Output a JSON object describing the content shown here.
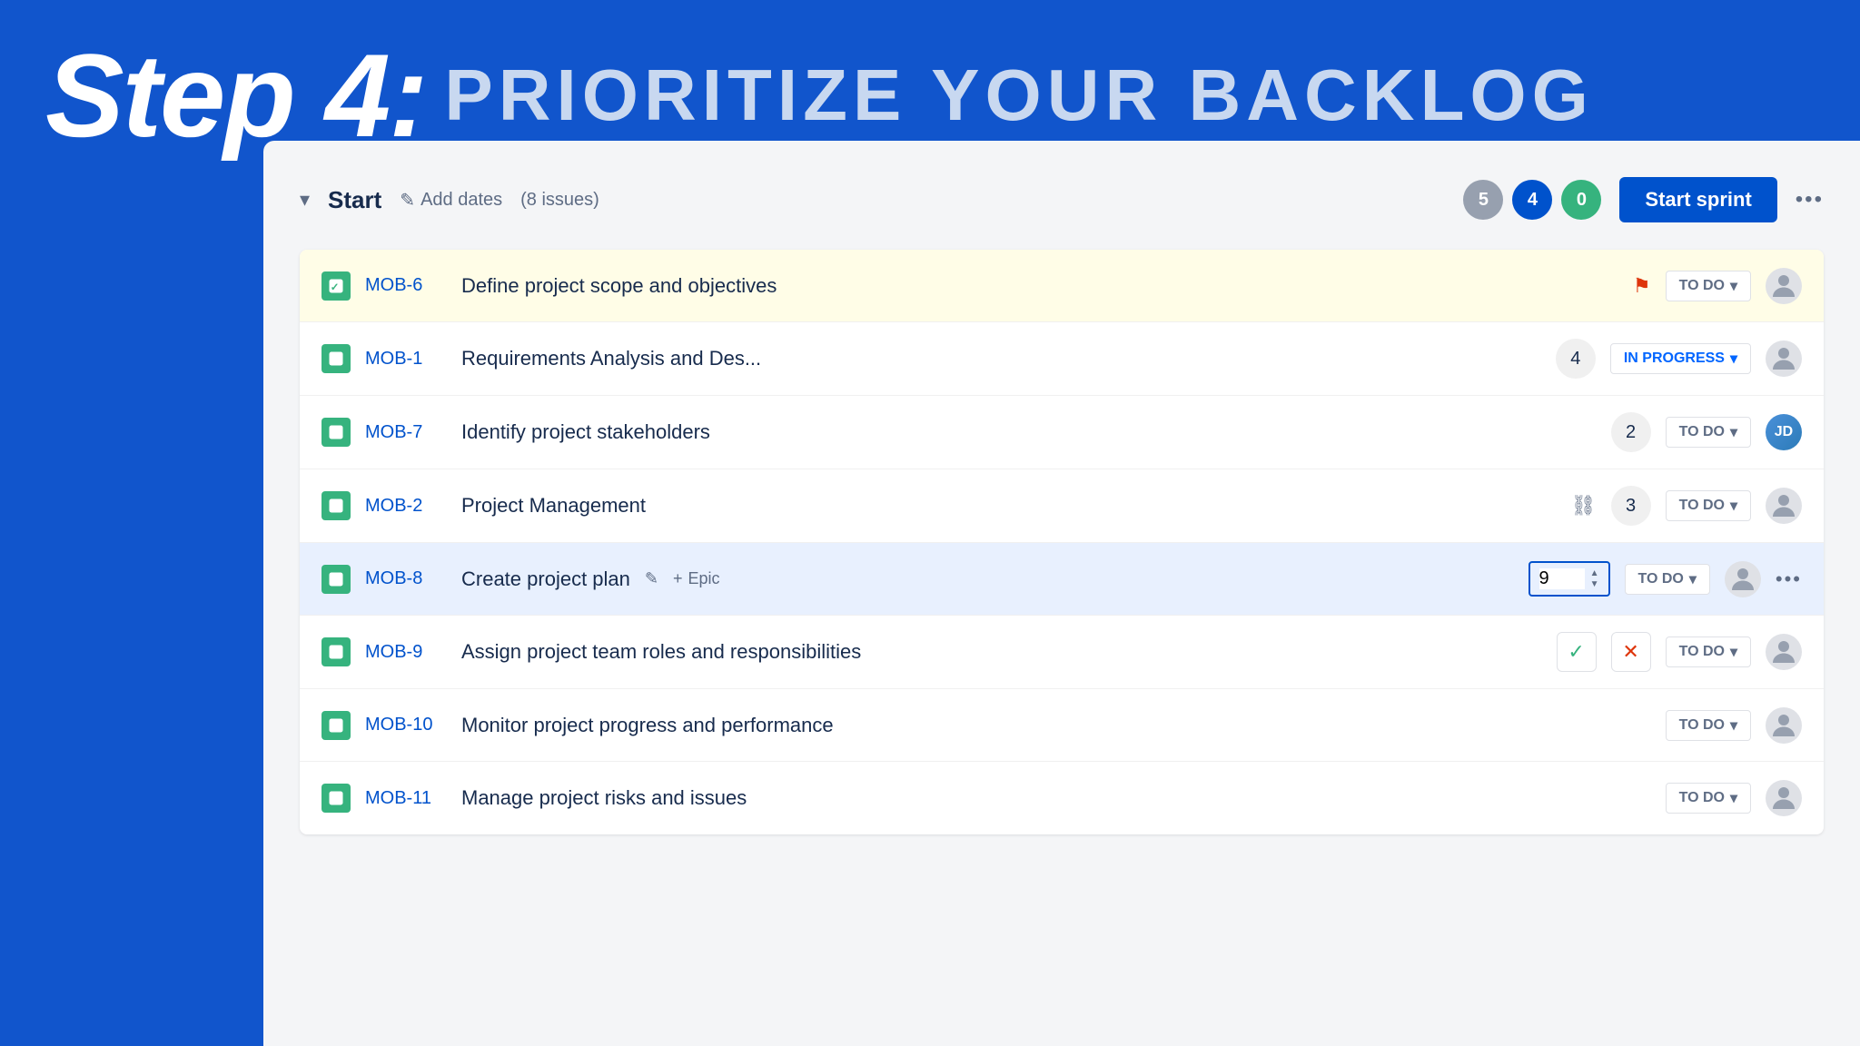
{
  "header": {
    "step_bold": "Step 4:",
    "step_subtitle": "PRIORITIZE YOUR BACKLOG"
  },
  "sprint": {
    "collapse_symbol": "▾",
    "title": "Start",
    "edit_dates_label": "Add dates",
    "issues_count": "(8 issues)",
    "badges": [
      {
        "value": "5",
        "type": "gray"
      },
      {
        "value": "4",
        "type": "blue"
      },
      {
        "value": "0",
        "type": "green"
      }
    ],
    "start_sprint_label": "Start sprint",
    "more_symbol": "•••"
  },
  "issues": [
    {
      "id": "MOB-6",
      "title": "Define project scope and objectives",
      "flag": true,
      "story_points": null,
      "status": "TO DO",
      "status_type": "todo",
      "avatar_type": "default",
      "highlighted": true,
      "editing": false
    },
    {
      "id": "MOB-1",
      "title": "Requirements Analysis and Des...",
      "flag": false,
      "story_points": "4",
      "status": "IN PROGRESS",
      "status_type": "in-progress",
      "avatar_type": "default",
      "highlighted": false,
      "editing": false
    },
    {
      "id": "MOB-7",
      "title": "Identify project stakeholders",
      "flag": false,
      "story_points": "2",
      "status": "TO DO",
      "status_type": "todo",
      "avatar_type": "photo",
      "highlighted": false,
      "editing": false
    },
    {
      "id": "MOB-2",
      "title": "Project Management",
      "flag": false,
      "story_points": "3",
      "status": "TO DO",
      "status_type": "todo",
      "avatar_type": "default",
      "highlighted": false,
      "editing": false,
      "hierarchy": true
    },
    {
      "id": "MOB-8",
      "title": "Create project plan",
      "flag": false,
      "story_points": "9",
      "status": "TO DO",
      "status_type": "todo",
      "avatar_type": "default",
      "highlighted": false,
      "editing": true,
      "has_epic": true,
      "has_pencil": true
    },
    {
      "id": "MOB-9",
      "title": "Assign project team roles and responsibilities",
      "flag": false,
      "story_points": null,
      "status": "TO DO",
      "status_type": "todo",
      "avatar_type": "default",
      "highlighted": false,
      "editing": false,
      "confirm_cancel": true
    },
    {
      "id": "MOB-10",
      "title": "Monitor project progress and performance",
      "flag": false,
      "story_points": null,
      "status": "TO DO",
      "status_type": "todo",
      "avatar_type": "default",
      "highlighted": false,
      "editing": false
    },
    {
      "id": "MOB-11",
      "title": "Manage project risks and issues",
      "flag": false,
      "story_points": null,
      "status": "TO DO",
      "status_type": "todo",
      "avatar_type": "default",
      "highlighted": false,
      "editing": false
    }
  ],
  "icons": {
    "chevron_down": "▾",
    "pencil": "✎",
    "plus": "+",
    "checkmark": "✓",
    "cross": "✕",
    "flag": "⚑",
    "dots": "•••"
  }
}
